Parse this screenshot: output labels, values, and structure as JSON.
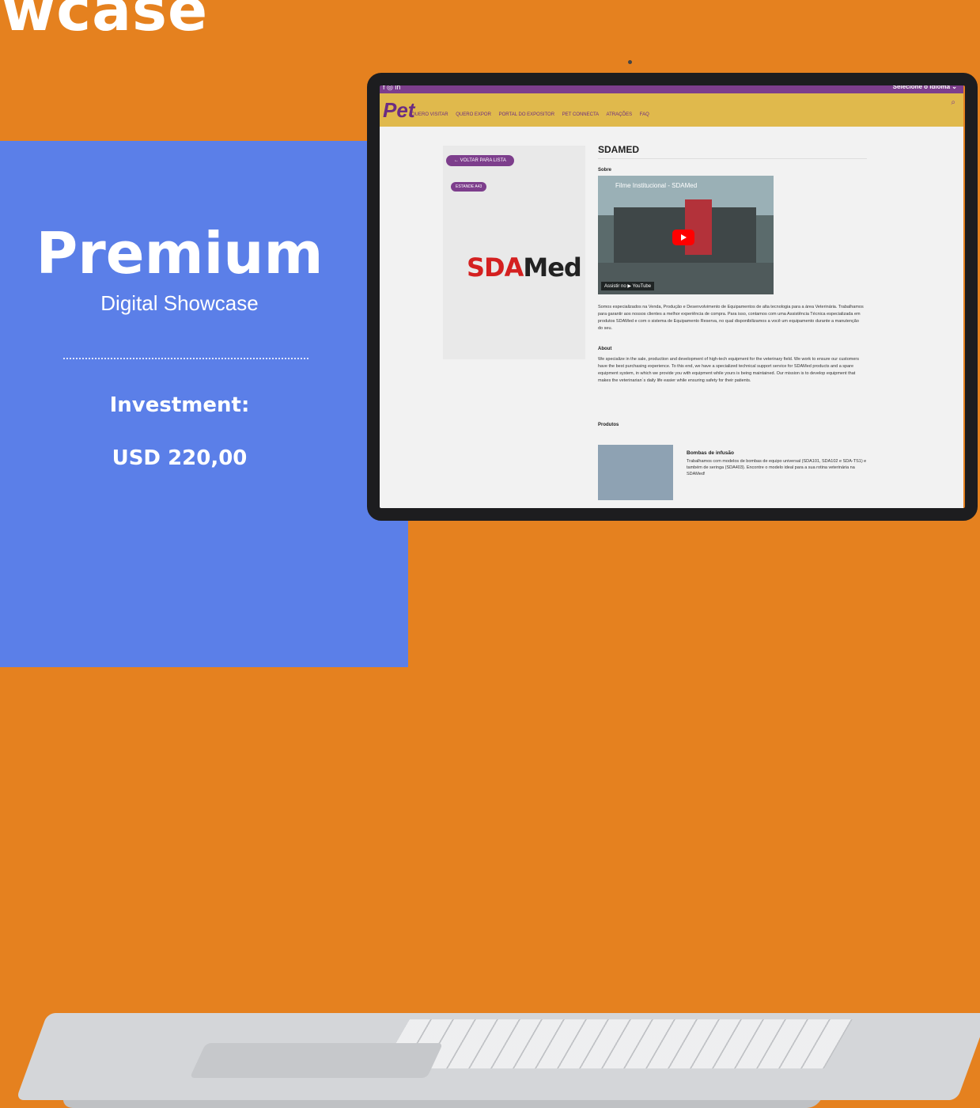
{
  "headline": "owcase",
  "promo": {
    "title": "Premium",
    "subtitle": "Digital Showcase",
    "investment_label": "Investment:",
    "price": "USD 220,00"
  },
  "site": {
    "social": "f ◎ in",
    "language_label": "Selecione o idioma ⌄",
    "logo": "Pet",
    "nav": [
      "QUERO VISITAR",
      "QUERO EXPOR",
      "PORTAL DO EXPOSITOR",
      "PET CONNECTA",
      "ATRAÇÕES",
      "FAQ"
    ],
    "back_button": "← VOLTAR PARA LISTA",
    "booth": "ESTANDE A43",
    "exhibitor_logo_a": "SDA",
    "exhibitor_logo_b": "Med",
    "exhibitor_title": "SDAMED",
    "about_pt_label": "Sobre",
    "video_title": "Filme Institucional - SDAMed",
    "video_watch": "Assistir no ▶ YouTube",
    "about_pt_text": "Somos especializados na Venda, Produção e Desenvolvimento de Equipamentos de alta tecnologia para a área Veterinária. Trabalhamos para garantir aos nossos clientes a melhor experiência de compra. Para isso, contamos com uma Assistência Técnica especializada em produtos SDAMed e com o sistema de Equipamento Reserva, no qual disponibilizamos a você um equipamento durante a manutenção do seu.",
    "about_en_label": "About",
    "about_en_text": "We specialize in the sale, production and development of high-tech equipment for the veterinary field. We work to ensure our customers have the best purchasing experience. To this end, we have a specialized technical support service for SDAMed products and a spare equipment system, in which we provide you with equipment while yours is being maintained. Our mission is to develop equipment that makes the veterinarian´s daily life easier while ensuring safety for their patients.",
    "products_label": "Produtos",
    "product_title": "Bombas de infusão",
    "product_text": "Trabalhamos com modelos de bombas de equipo universal (SDA101, SDA102 e SDA-TS1) e também de seringa (SDA403). Encontre o modelo ideal para a sua rotina veterinária na SDAMed!"
  },
  "colors": {
    "orange": "#e5811f",
    "blue": "#5b7fe8",
    "purple": "#7d3e8c",
    "gold": "#e0b94c"
  }
}
